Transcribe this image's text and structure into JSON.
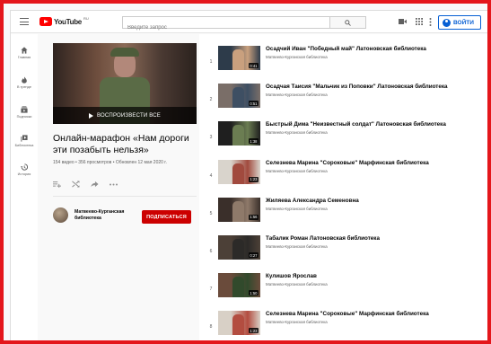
{
  "header": {
    "logo_text": "YouTube",
    "logo_region": "RU",
    "search_placeholder": "Введите запрос",
    "signin_label": "ВОЙТИ",
    "icons": [
      "menu-icon",
      "search-icon",
      "create-video-icon",
      "apps-grid-icon",
      "more-vert-icon",
      "account-icon"
    ]
  },
  "sidebar": {
    "items": [
      {
        "label": "Главная",
        "icon": "home-icon"
      },
      {
        "label": "В тренде",
        "icon": "trending-icon"
      },
      {
        "label": "Подписки",
        "icon": "subscriptions-icon"
      },
      {
        "label": "Библиотека",
        "icon": "library-icon"
      },
      {
        "label": "История",
        "icon": "history-icon"
      }
    ]
  },
  "playlist": {
    "play_all_label": "ВОСПРОИЗВЕСТИ ВСЕ",
    "title": "Онлайн-марафон «Нам дороги эти позабыть нельзя»",
    "meta": "154 видео • 356 просмотров • Обновлен 12 мая 2020 г.",
    "actions": [
      "add-to-queue-icon",
      "shuffle-icon",
      "share-icon",
      "more-horiz-icon"
    ],
    "owner_name": "Матвеево-Курганская библиотека",
    "subscribe_label": "ПОДПИСАТЬСЯ"
  },
  "videos": [
    {
      "index": "1",
      "title": "Осадчий Иван \"Победный май\" Латоновская библиотека",
      "channel": "Матвеево-Курганская библиотека",
      "duration": "0:41"
    },
    {
      "index": "2",
      "title": "Осадчая Таисия \"Мальчик из Поповки\" Латоновская библиотека",
      "channel": "Матвеево-Курганская библиотека",
      "duration": "0:51"
    },
    {
      "index": "3",
      "title": "Быстрый Дима \"Неизвестный солдат\" Латоновская библиотека",
      "channel": "Матвеево-Курганская библиотека",
      "duration": "1:38"
    },
    {
      "index": "4",
      "title": "Селезнева Марина \"Сороковые\" Марфинская библиотека",
      "channel": "Матвеево-Курганская библиотека",
      "duration": "1:23"
    },
    {
      "index": "5",
      "title": "Жиляева Александра Семеновна",
      "channel": "Матвеево-Курганская библиотека",
      "duration": "1:56"
    },
    {
      "index": "6",
      "title": "Табалик Роман Латоновская библиотека",
      "channel": "Матвеево-Курганская библиотека",
      "duration": "0:27"
    },
    {
      "index": "7",
      "title": "Кулишов Ярослав",
      "channel": "Матвеево-Курганская библиотека",
      "duration": "1:50"
    },
    {
      "index": "8",
      "title": "Селезнева Марина \"Сороковые\" Марфинская библиотека",
      "channel": "Матвеево-Курганская библиотека",
      "duration": "1:23"
    }
  ],
  "colors": {
    "frame": "#e4161b",
    "brand_red": "#ff0000",
    "subscribe_red": "#cc0000",
    "link_blue": "#065fd4"
  }
}
